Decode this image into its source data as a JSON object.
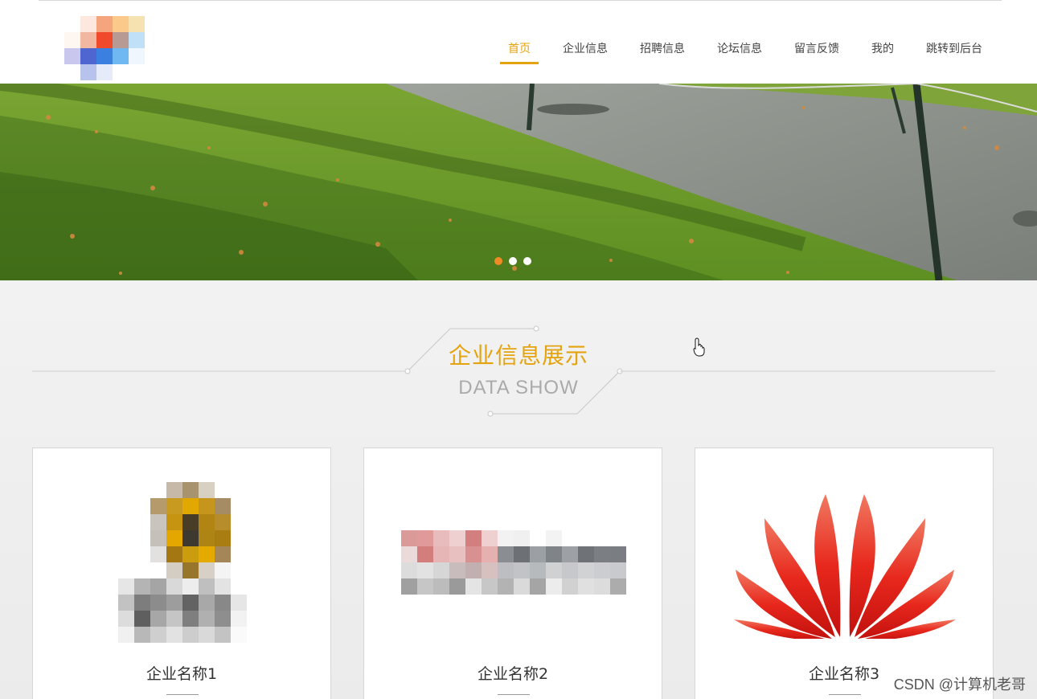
{
  "header": {
    "logo_icon": "blurred-logo-icon",
    "nav": [
      {
        "label": "首页",
        "active": true
      },
      {
        "label": "企业信息",
        "active": false
      },
      {
        "label": "招聘信息",
        "active": false
      },
      {
        "label": "论坛信息",
        "active": false
      },
      {
        "label": "留言反馈",
        "active": false
      },
      {
        "label": "我的",
        "active": false
      },
      {
        "label": "跳转到后台",
        "active": false
      }
    ]
  },
  "banner": {
    "image": "grass-and-path-photo",
    "slides": 3,
    "active_slide": 1
  },
  "section": {
    "title": "企业信息展示",
    "subtitle": "DATA SHOW"
  },
  "cards": [
    {
      "name": "企业名称1",
      "logo_icon": "blurred-company-logo-icon"
    },
    {
      "name": "企业名称2",
      "logo_icon": "blurred-company-logo-icon"
    },
    {
      "name": "企业名称3",
      "logo_icon": "huawei-logo-icon"
    }
  ],
  "watermark": "CSDN @计算机老哥",
  "colors": {
    "accent": "#e4a30f",
    "dot_active": "#f08a24"
  }
}
